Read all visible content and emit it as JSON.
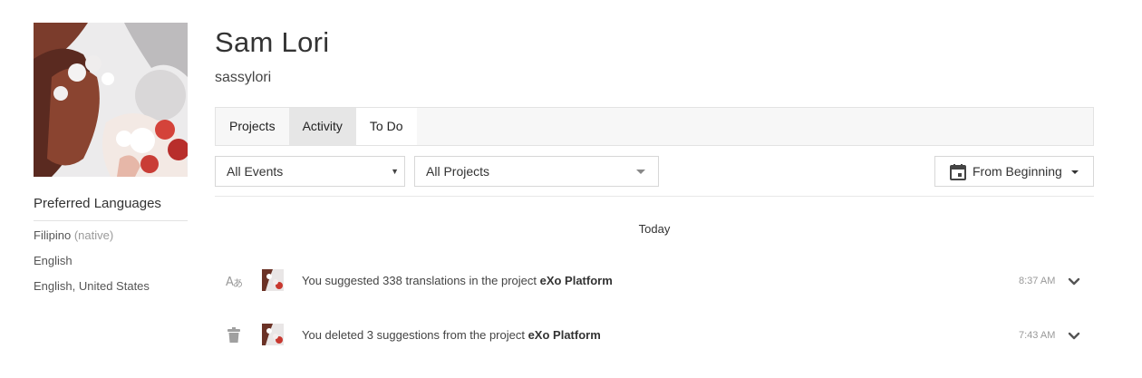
{
  "profile": {
    "name": "Sam Lori",
    "username": "sassylori",
    "avatar_icon": "profile-photo"
  },
  "languages": {
    "title": "Preferred Languages",
    "items": [
      {
        "label": "Filipino",
        "note": "(native)"
      },
      {
        "label": "English",
        "note": ""
      },
      {
        "label": "English, United States",
        "note": ""
      }
    ]
  },
  "tabs": [
    {
      "label": "Projects"
    },
    {
      "label": "Activity"
    },
    {
      "label": "To Do"
    }
  ],
  "filters": {
    "events": "All Events",
    "projects": "All Projects",
    "range": "From Beginning",
    "range_icon": "calendar-icon"
  },
  "activity": {
    "day_label": "Today",
    "events": [
      {
        "icon": "translate-icon",
        "text": "You suggested 338 translations in the project ",
        "project": "eXo Platform",
        "time": "8:37 AM"
      },
      {
        "icon": "trash-icon",
        "text": "You deleted 3 suggestions from the project ",
        "project": "eXo Platform",
        "time": "7:43 AM"
      }
    ]
  },
  "colors": {
    "tab_active_bg": "#e6e6e6",
    "tab_bar_bg": "#f7f7f7",
    "border": "#d7d7d7",
    "muted_text": "#999999"
  }
}
